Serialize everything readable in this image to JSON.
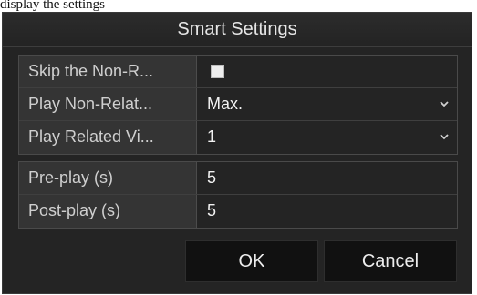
{
  "caption": "display the settings",
  "dialog": {
    "title": "Smart Settings",
    "rows": [
      {
        "label": "Skip the Non-R...",
        "value": "",
        "control": "checkbox",
        "checked": false
      },
      {
        "label": "Play Non-Relat...",
        "value": "Max.",
        "control": "dropdown",
        "icon": "chevron-down-icon"
      },
      {
        "label": "Play Related Vi...",
        "value": "1",
        "control": "dropdown",
        "icon": "chevron-down-icon"
      },
      {
        "label": "Pre-play (s)",
        "value": "5",
        "control": "text"
      },
      {
        "label": "Post-play (s)",
        "value": "5",
        "control": "text"
      }
    ],
    "buttons": {
      "ok": "OK",
      "cancel": "Cancel"
    }
  },
  "colors": {
    "background": "#242424",
    "label_cell": "#343434",
    "button": "#111111",
    "text": "#f2f2f2"
  }
}
